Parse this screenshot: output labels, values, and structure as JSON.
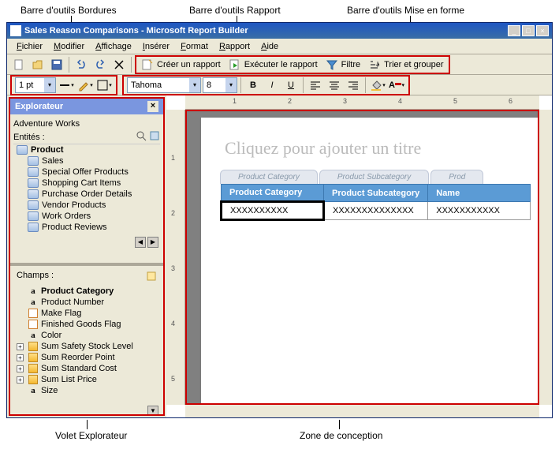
{
  "annotations": {
    "border_toolbar": "Barre d'outils Bordures",
    "report_toolbar": "Barre d'outils Rapport",
    "format_toolbar": "Barre d'outils Mise en forme",
    "explorer_pane": "Volet Explorateur",
    "design_zone": "Zone de conception"
  },
  "titlebar": "Sales Reason Comparisons - Microsoft Report Builder",
  "menu": {
    "file": "Fichier",
    "edit": "Modifier",
    "view": "Affichage",
    "insert": "Insérer",
    "format": "Format",
    "report": "Rapport",
    "help": "Aide"
  },
  "report_toolbar": {
    "create": "Créer un rapport",
    "run": "Exécuter le rapport",
    "filter": "Filtre",
    "sort": "Trier et grouper"
  },
  "border_toolbar": {
    "line_width": "1 pt"
  },
  "format_toolbar": {
    "font": "Tahoma",
    "size": "8"
  },
  "explorer": {
    "title": "Explorateur",
    "datasource": "Adventure Works",
    "entities_label": "Entités :",
    "entities": [
      {
        "label": "Product",
        "selected": true,
        "indent": 0
      },
      {
        "label": "Sales",
        "indent": 1
      },
      {
        "label": "Special Offer Products",
        "indent": 1
      },
      {
        "label": "Shopping Cart Items",
        "indent": 1
      },
      {
        "label": "Purchase Order Details",
        "indent": 1
      },
      {
        "label": "Vendor Products",
        "indent": 1
      },
      {
        "label": "Work Orders",
        "indent": 1
      },
      {
        "label": "Product Reviews",
        "indent": 1
      }
    ],
    "fields_label": "Champs :",
    "fields": [
      {
        "label": "Product Category",
        "type": "a",
        "bold": true
      },
      {
        "label": "Product Number",
        "type": "a"
      },
      {
        "label": "Make Flag",
        "type": "flag"
      },
      {
        "label": "Finished Goods Flag",
        "type": "flag"
      },
      {
        "label": "Color",
        "type": "a"
      },
      {
        "label": "Sum Safety Stock Level",
        "type": "sum",
        "expand": true
      },
      {
        "label": "Sum Reorder Point",
        "type": "sum",
        "expand": true
      },
      {
        "label": "Sum Standard Cost",
        "type": "sum",
        "expand": true
      },
      {
        "label": "Sum List Price",
        "type": "sum",
        "expand": true
      },
      {
        "label": "Size",
        "type": "a"
      }
    ]
  },
  "design": {
    "title_placeholder": "Cliquez pour ajouter un titre",
    "tabs": [
      "Product Category",
      "Product Subcategory",
      "Prod"
    ],
    "columns": [
      "Product Category",
      "Product Subcategory",
      "Name"
    ],
    "row": [
      "XXXXXXXXXX",
      "XXXXXXXXXXXXXX",
      "XXXXXXXXXXX"
    ]
  }
}
